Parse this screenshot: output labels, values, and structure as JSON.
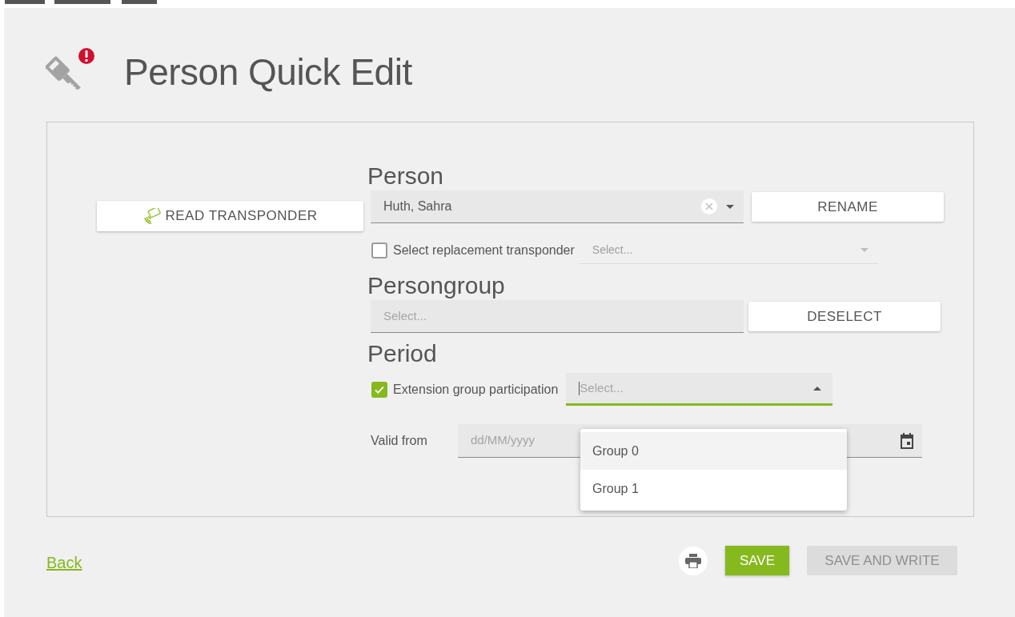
{
  "header": {
    "title": "Person Quick Edit",
    "alert": true
  },
  "read_transponder_button": "READ TRANSPONDER",
  "person": {
    "heading": "Person",
    "value": "Huth, Sahra",
    "rename_button": "RENAME"
  },
  "replacement": {
    "label": "Select replacement transponder",
    "checked": false,
    "placeholder": "Select..."
  },
  "persongroup": {
    "heading": "Persongroup",
    "placeholder": "Select...",
    "deselect_button": "DESELECT"
  },
  "period": {
    "heading": "Period",
    "extension": {
      "label": "Extension group participation",
      "checked": true,
      "placeholder": "Select...",
      "expanded": true,
      "options": [
        {
          "label": "Group 0",
          "selected": true
        },
        {
          "label": "Group 1",
          "selected": false
        }
      ]
    },
    "valid_from": {
      "label": "Valid from",
      "placeholder": "dd/MM/yyyy"
    }
  },
  "footer": {
    "back_link": "Back",
    "save_button": "SAVE",
    "save_and_write": {
      "label": "SAVE AND WRITE",
      "disabled": true
    }
  }
}
